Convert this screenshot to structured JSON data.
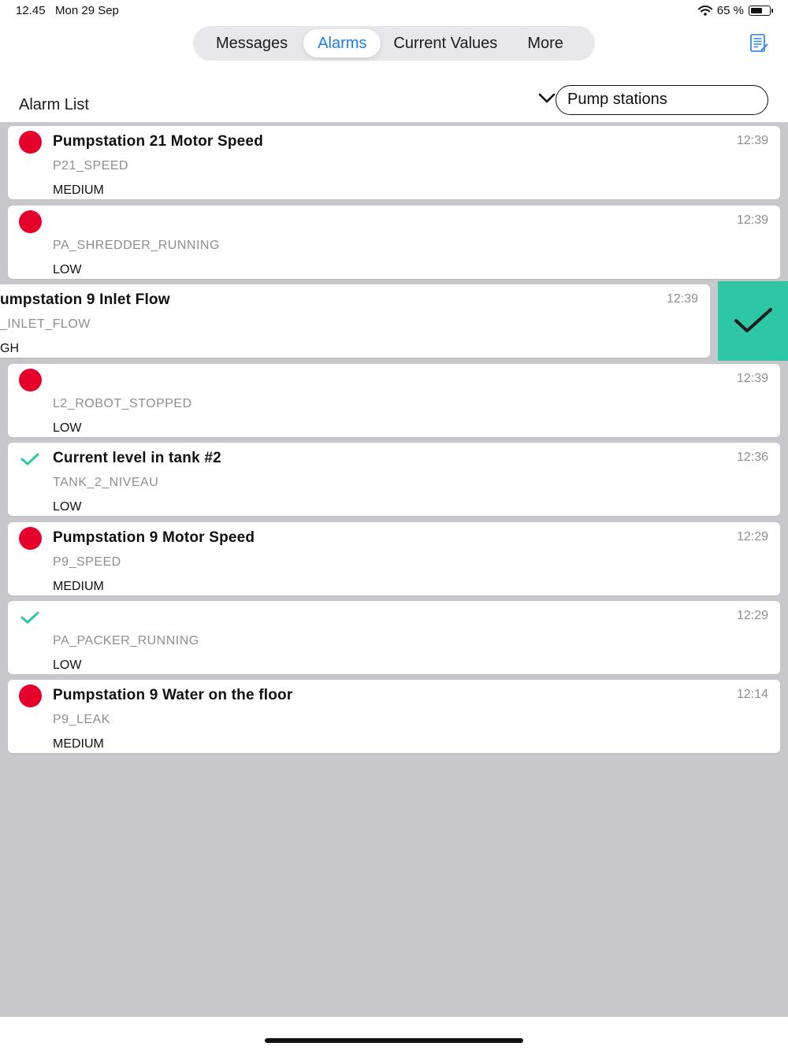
{
  "status_bar": {
    "time": "12.45",
    "date": "Mon 29 Sep",
    "wifi_icon": "wifi-icon",
    "battery_percent": "65 %",
    "battery_level": 0.65
  },
  "tabs": [
    {
      "label": "Messages",
      "active": false
    },
    {
      "label": "Alarms",
      "active": true
    },
    {
      "label": "Current Values",
      "active": false
    },
    {
      "label": "More",
      "active": false
    }
  ],
  "header": {
    "title": "Alarm List",
    "filter_value": "Pump stations",
    "report_icon": "report-list-icon",
    "chevron_icon": "chevron-down-icon"
  },
  "colors": {
    "accent": "#1a7ff0",
    "alarm_active": "#e6002c",
    "acknowledged": "#2ec7a6",
    "list_background": "#c8c8cc"
  },
  "alarms": [
    {
      "status": "active",
      "title": "Pumpstation 21 Motor Speed",
      "tag": "P21_SPEED",
      "severity": "MEDIUM",
      "time": "12:39"
    },
    {
      "status": "active",
      "title": "",
      "tag": "PA_SHREDDER_RUNNING",
      "severity": "LOW",
      "time": "12:39"
    },
    {
      "status": "swiped",
      "title": "umpstation 9 Inlet Flow",
      "tag": "_INLET_FLOW",
      "severity": "GH",
      "time": "12:39",
      "swipe_action_icon": "checkmark-icon"
    },
    {
      "status": "active",
      "title": "",
      "tag": "L2_ROBOT_STOPPED",
      "severity": "LOW",
      "time": "12:39"
    },
    {
      "status": "acknowledged",
      "title": "Current level in tank #2",
      "tag": "TANK_2_NIVEAU",
      "severity": "LOW",
      "time": "12:36"
    },
    {
      "status": "active",
      "title": "Pumpstation 9 Motor Speed",
      "tag": "P9_SPEED",
      "severity": "MEDIUM",
      "time": "12:29"
    },
    {
      "status": "acknowledged",
      "title": "",
      "tag": "PA_PACKER_RUNNING",
      "severity": "LOW",
      "time": "12:29"
    },
    {
      "status": "active",
      "title": "Pumpstation 9 Water on the floor",
      "tag": "P9_LEAK",
      "severity": "MEDIUM",
      "time": "12:14"
    }
  ]
}
